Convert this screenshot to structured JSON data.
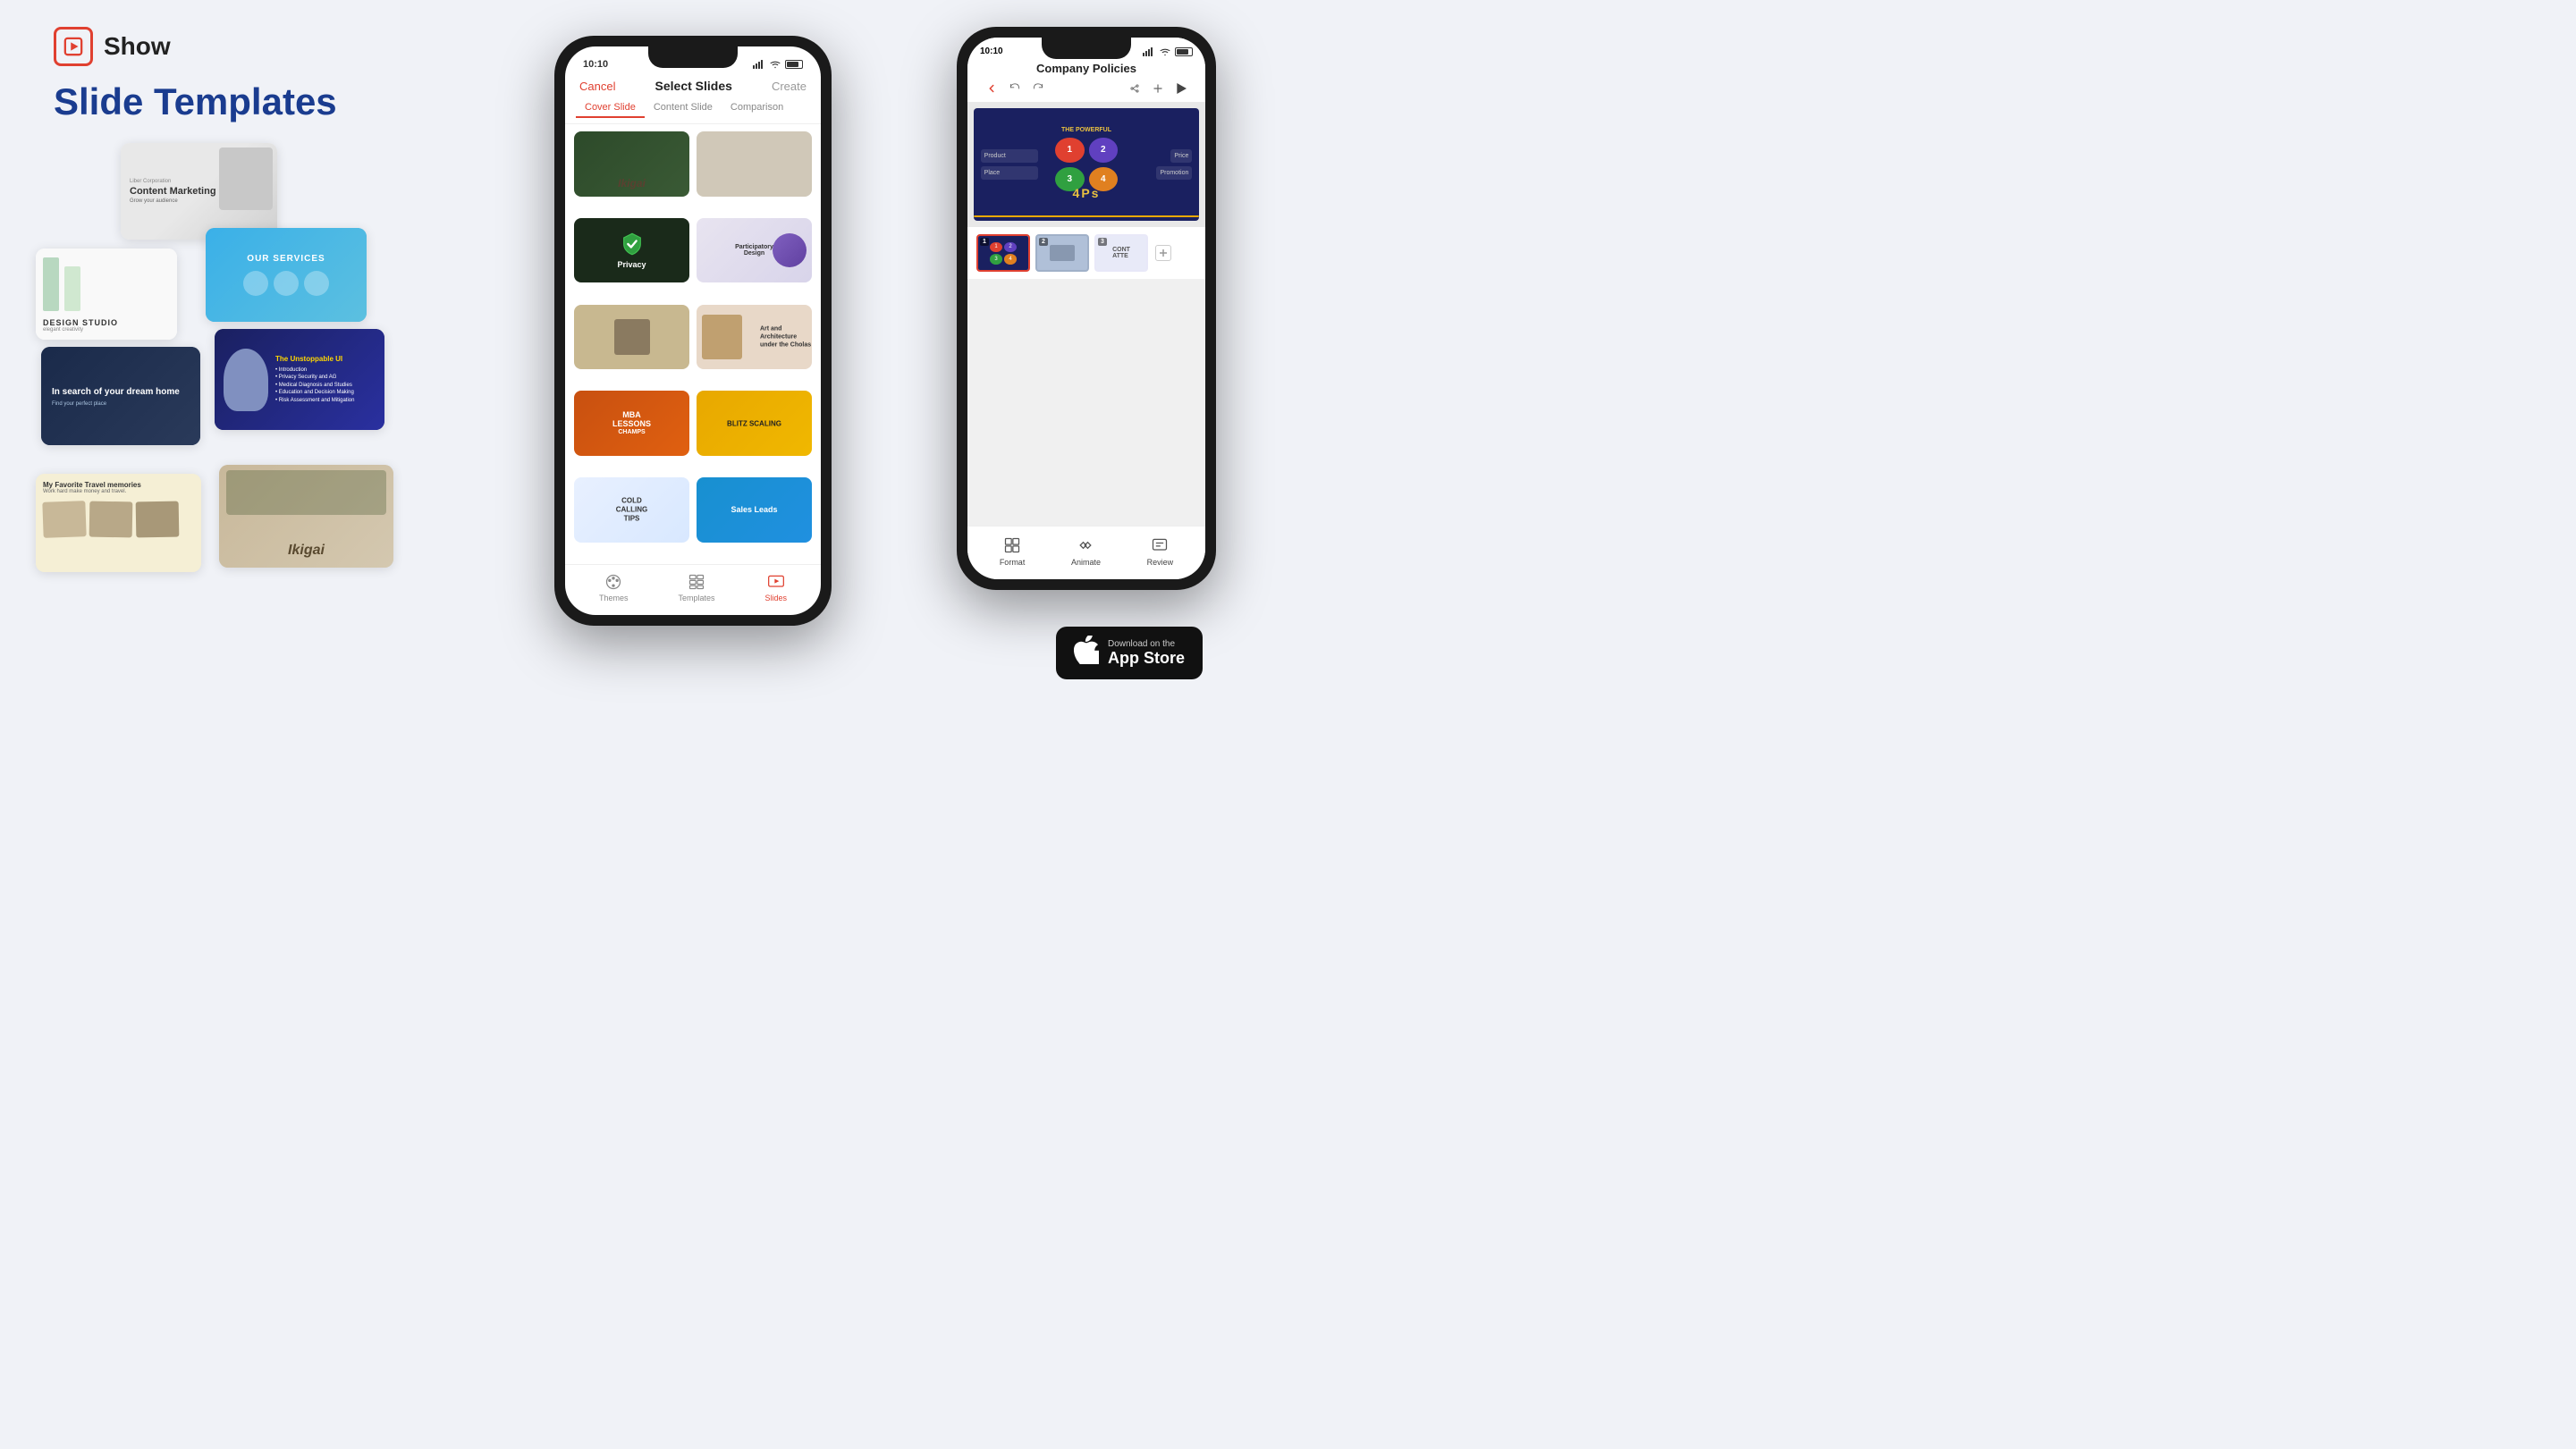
{
  "logo": {
    "text": "Show"
  },
  "header": {
    "title": "Slide Templates"
  },
  "phone_center": {
    "status_time": "10:10",
    "nav": {
      "cancel": "Cancel",
      "title": "Select Slides",
      "create": "Create"
    },
    "tabs": [
      {
        "label": "Cover Slide",
        "active": true
      },
      {
        "label": "Content Slide",
        "active": false
      },
      {
        "label": "Comparison",
        "active": false
      }
    ],
    "slides": [
      {
        "label": "Ikigai",
        "type": "ikigai"
      },
      {
        "label": "",
        "type": "book"
      },
      {
        "label": "Privacy",
        "type": "privacy"
      },
      {
        "label": "Participatory Design",
        "type": "participatory"
      },
      {
        "label": "",
        "type": "dark"
      },
      {
        "label": "Art and Architecture under the Cholas",
        "type": "art"
      },
      {
        "label": "MBA LESSONS CHAMPS",
        "type": "mba"
      },
      {
        "label": "BLITZ SCALING",
        "type": "blitz"
      },
      {
        "label": "COLD CALLING TIPS",
        "type": "cold"
      },
      {
        "label": "Sales Leads",
        "type": "sales"
      }
    ],
    "bottom_nav": [
      {
        "label": "Themes",
        "active": false
      },
      {
        "label": "Templates",
        "active": false
      },
      {
        "label": "Slides",
        "active": true
      }
    ]
  },
  "phone_right": {
    "status_time": "10:10",
    "title": "Company Policies",
    "slide_label": "4Ps",
    "slide_subtitle": "THE POWERFUL",
    "thumbnails": [
      {
        "num": "1",
        "active": true
      },
      {
        "num": "2",
        "active": false
      },
      {
        "num": "3",
        "active": false
      }
    ],
    "toolbar": [
      {
        "label": "Format",
        "icon": "format"
      },
      {
        "label": "Animate",
        "icon": "animate"
      },
      {
        "label": "Review",
        "icon": "review"
      }
    ]
  },
  "left_cards": [
    {
      "id": "content-marketing",
      "title": "Content Marketing",
      "subtitle": "Grow your audience"
    },
    {
      "id": "design-studio",
      "title": "DESIGN STUDIO",
      "subtitle": "elegant creativity"
    },
    {
      "id": "our-services",
      "title": "OUR SERVICES"
    },
    {
      "id": "dream-home",
      "title": "In search of your dream home"
    },
    {
      "id": "unstoppable-ui",
      "title": "The Unstoppable UI"
    },
    {
      "id": "travel-memories",
      "title": "My Favorite Travel memories",
      "subtitle": "Work hard make money and travel."
    },
    {
      "id": "ikigai-card",
      "title": "Ikigai"
    }
  ],
  "appstore": {
    "top_text": "Download on the",
    "bottom_text": "App Store"
  }
}
